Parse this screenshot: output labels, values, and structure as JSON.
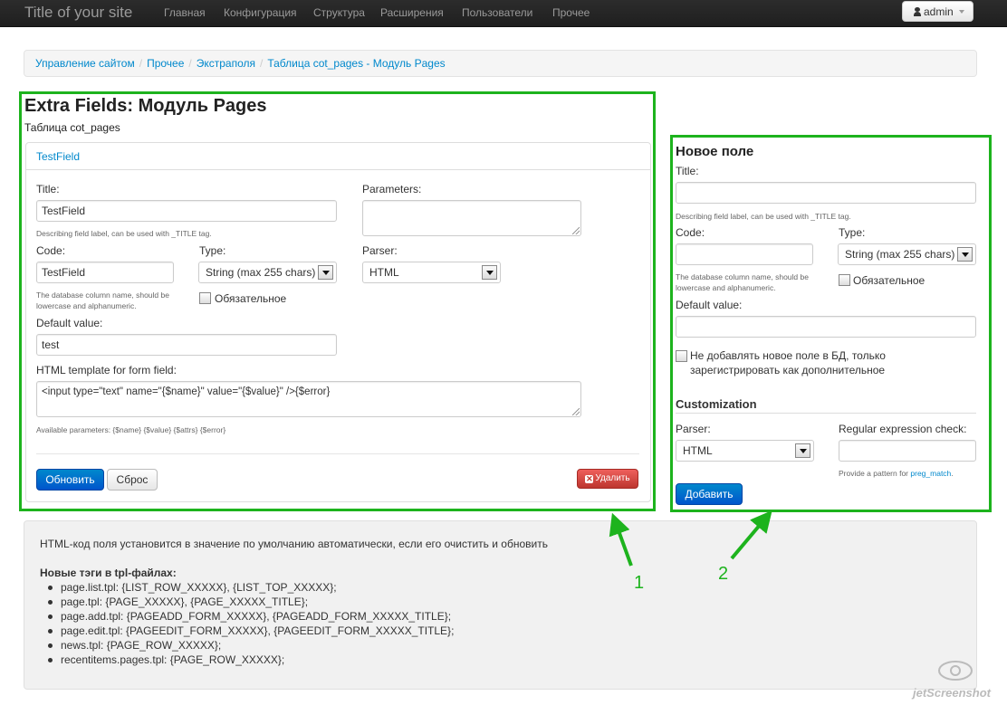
{
  "navbar": {
    "brand": "Title of your site",
    "items": [
      "Главная",
      "Конфигурация",
      "Структура",
      "Расширения",
      "Пользователи",
      "Прочее"
    ],
    "user": "admin"
  },
  "breadcrumb": [
    "Управление сайтом",
    "Прочее",
    "Экстраполя",
    "Таблица cot_pages - Модуль Pages"
  ],
  "panel1": {
    "heading": "Extra Fields: Модуль Pages",
    "subheading": "Таблица cot_pages",
    "card_title": "TestField",
    "title_label": "Title:",
    "title_value": "TestField",
    "title_hint": "Describing field label, can be used with _TITLE tag.",
    "code_label": "Code:",
    "code_value": "TestField",
    "code_hint": "The database column name, should be lowercase and alphanumeric.",
    "type_label": "Type:",
    "type_value": "String (max 255 chars)",
    "required_label": "Обязательное",
    "default_label": "Default value:",
    "default_value": "test",
    "html_label": "HTML template for form field:",
    "html_value": "<input type=\"text\" name=\"{$name}\" value=\"{$value}\"  />{$error}",
    "html_hint": "Available parameters: {$name} {$value} {$attrs} {$error}",
    "params_label": "Parameters:",
    "parser_label": "Parser:",
    "parser_value": "HTML",
    "update_button": "Обновить",
    "reset_button": "Сброс",
    "delete_button": "Удалить"
  },
  "panel2": {
    "heading": "Новое поле",
    "title_label": "Title:",
    "title_hint": "Describing field label, can be used with _TITLE tag.",
    "code_label": "Code:",
    "code_hint": "The database column name, should be lowercase and alphanumeric.",
    "type_label": "Type:",
    "type_value": "String (max 255 chars)",
    "required_label": "Обязательное",
    "default_label": "Default value:",
    "noadd_label": "Не добавлять новое поле в БД, только зарегистрировать как дополнительное",
    "customization_title": "Customization",
    "parser_label": "Parser:",
    "parser_value": "HTML",
    "regex_label": "Regular expression check:",
    "regex_hint_prefix": "Provide a pattern for",
    "regex_hint_link": "preg_match",
    "regex_hint_suffix": ".",
    "add_button": "Добавить"
  },
  "info": {
    "text": "HTML-код поля установится в значение по умолчанию автоматически, если его очистить и обновить",
    "tags_title": "Новые тэги в tpl-файлах:",
    "tags": [
      "page.list.tpl: {LIST_ROW_XXXXX}, {LIST_TOP_XXXXX};",
      "page.tpl: {PAGE_XXXXX}, {PAGE_XXXXX_TITLE};",
      "page.add.tpl: {PAGEADD_FORM_XXXXX}, {PAGEADD_FORM_XXXXX_TITLE};",
      "page.edit.tpl: {PAGEEDIT_FORM_XXXXX}, {PAGEEDIT_FORM_XXXXX_TITLE};",
      "news.tpl: {PAGE_ROW_XXXXX};",
      "recentitems.pages.tpl: {PAGE_ROW_XXXXX};"
    ]
  },
  "annotations": {
    "label1": "1",
    "label2": "2",
    "color": "#1db31d"
  },
  "watermark": "jetScreenshot",
  "colors": {
    "accent": "#0088cc",
    "danger": "#da4f49",
    "navbar": "#222222"
  }
}
